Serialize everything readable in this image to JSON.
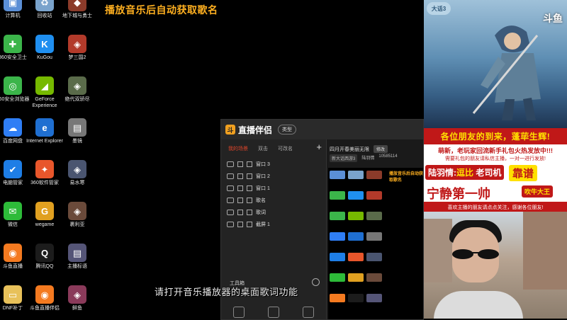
{
  "stream": {
    "overlay_title": "播放音乐后自动获取歌名",
    "subtitle": "请打开音乐播放器的桌面歌词功能"
  },
  "desktop_icons": [
    {
      "label": "计算机",
      "icon": "computer-icon",
      "color": "#5b8fd6"
    },
    {
      "label": "回收站",
      "icon": "recycle-bin-icon",
      "color": "#7aa3cc"
    },
    {
      "label": "地下城与勇士",
      "icon": "dnf-game-icon",
      "color": "#8b3b2a"
    },
    {
      "label": "360安全卫士",
      "icon": "360-safe-icon",
      "color": "#3bb54a"
    },
    {
      "label": "KuGou",
      "icon": "kugou-icon",
      "color": "#1f8ff0"
    },
    {
      "label": "梦三国2",
      "icon": "game-icon",
      "color": "#b23a2a"
    },
    {
      "label": "360安全浏览器",
      "icon": "360-browser-icon",
      "color": "#3bb54a"
    },
    {
      "label": "GeForce Experience",
      "icon": "nvidia-icon",
      "color": "#76b900"
    },
    {
      "label": "绝代双骄尽",
      "icon": "game-icon",
      "color": "#5a6b4a"
    },
    {
      "label": "百度网盘",
      "icon": "baidu-netdisk-icon",
      "color": "#2f7ef5"
    },
    {
      "label": "Internet Explorer",
      "icon": "ie-icon",
      "color": "#1f6fd1"
    },
    {
      "label": "墨镜",
      "icon": "image-icon",
      "color": "#777777"
    },
    {
      "label": "电脑管家",
      "icon": "pc-manager-icon",
      "color": "#1e7ee6"
    },
    {
      "label": "360软件管家",
      "icon": "360-software-icon",
      "color": "#e8562b"
    },
    {
      "label": "易水寒",
      "icon": "game-icon",
      "color": "#4a5570"
    },
    {
      "label": "微信",
      "icon": "wechat-icon",
      "color": "#2dbb39"
    },
    {
      "label": "wegame",
      "icon": "wegame-icon",
      "color": "#e0a020"
    },
    {
      "label": "裹利亚",
      "icon": "game-icon",
      "color": "#6a4a3a"
    },
    {
      "label": "斗鱼直播",
      "icon": "douyu-icon",
      "color": "#f47a20"
    },
    {
      "label": "腾讯QQ",
      "icon": "qq-icon",
      "color": "#1c1c1c"
    },
    {
      "label": "主播标语",
      "icon": "image-icon",
      "color": "#555577"
    },
    {
      "label": "DNF补丁",
      "icon": "folder-icon",
      "color": "#e8c15a"
    },
    {
      "label": "斗鱼直播伴侣",
      "icon": "douyu-assistant-icon",
      "color": "#f47a20"
    },
    {
      "label": "鲜鱼",
      "icon": "game-icon",
      "color": "#8a3a5a"
    }
  ],
  "assistant": {
    "app_name": "直播伴侣",
    "type_button": "类型",
    "tabs": [
      "我的场景",
      "双击",
      "可改名"
    ],
    "add_label": "+",
    "scenes": [
      {
        "label": "窗口 3",
        "icon": "window-icon"
      },
      {
        "label": "窗口 2",
        "icon": "window-icon"
      },
      {
        "label": "窗口 1",
        "icon": "window-icon"
      },
      {
        "label": "歌名",
        "icon": "text-icon"
      },
      {
        "label": "歌词",
        "icon": "text-icon"
      },
      {
        "label": "截屏 1",
        "icon": "screenshot-icon"
      }
    ],
    "toolbox_label": "工具箱",
    "room_title": "四月开春美丽无限",
    "edit_button": "修改",
    "category": "新大话西游3",
    "host_name": "陆羽情",
    "room_id": "10585114",
    "preview_title": "播放音乐后自动获取歌名"
  },
  "banner": {
    "welcome": "各位朋友的到来，蓬荜生辉!",
    "line2": "萌新，老玩家回流新手礼包火热发放中!!!",
    "line3": "需要礼包的朋友请私信主播，一对一进行发放!",
    "host_label": "陆羽情:",
    "host_tag": "逗比",
    "host_tag2": "老司机",
    "boss": "靠谱",
    "big_name": "宁静第一帅",
    "tiger": "吹牛大王",
    "footer": "喜欢主播的朋友请点点关注，感谢各位朋友!"
  },
  "game_art": {
    "logo": "大话3",
    "badge": "斗鱼"
  },
  "colors": {
    "accent_orange": "#ffb020",
    "banner_red": "#c01818",
    "banner_yellow": "#ffe000",
    "tab_active": "#e0452a"
  }
}
